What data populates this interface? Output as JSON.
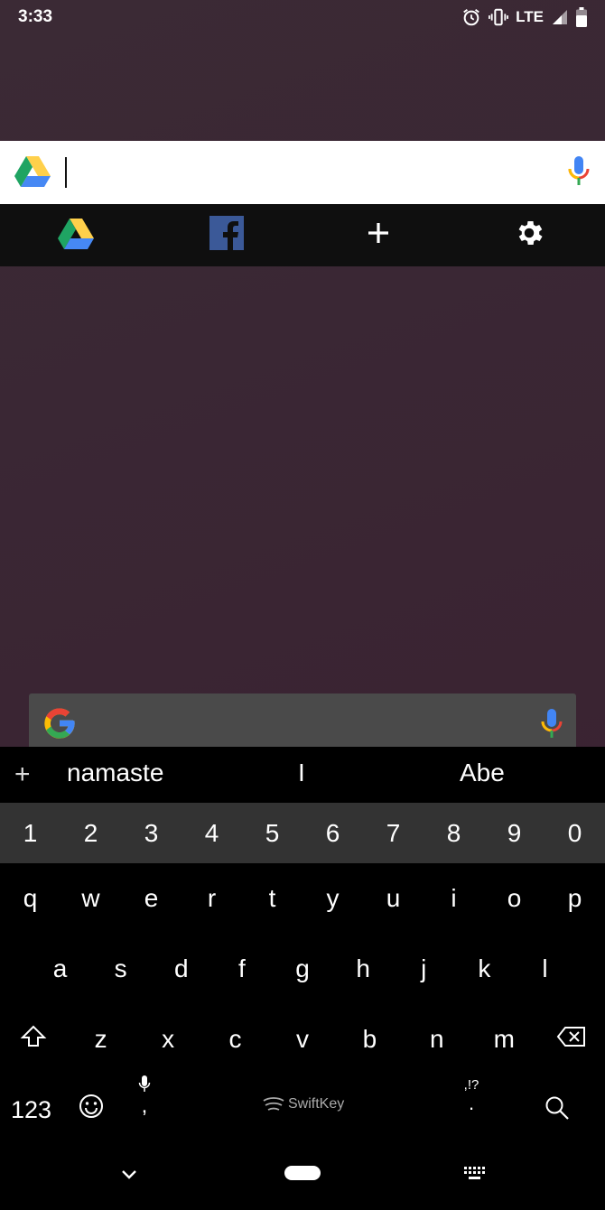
{
  "status_bar": {
    "time": "3:33",
    "network": "LTE",
    "icons": [
      "alarm-icon",
      "vibrate-icon",
      "signal-icon",
      "battery-icon"
    ]
  },
  "search_widget": {
    "leading_icon": "google-drive-icon",
    "trailing_icon": "google-mic-icon"
  },
  "shortcuts": [
    {
      "name": "google-drive-icon"
    },
    {
      "name": "facebook-icon"
    },
    {
      "name": "plus-icon"
    },
    {
      "name": "gear-icon"
    }
  ],
  "google_bar": {
    "leading_icon": "google-g-icon",
    "trailing_icon": "google-mic-icon"
  },
  "keyboard": {
    "suggestions": [
      "namaste",
      "I",
      "Abe"
    ],
    "suggestion_plus": "+",
    "number_row": [
      "1",
      "2",
      "3",
      "4",
      "5",
      "6",
      "7",
      "8",
      "9",
      "0"
    ],
    "row1": [
      "q",
      "w",
      "e",
      "r",
      "t",
      "y",
      "u",
      "i",
      "o",
      "p"
    ],
    "row2": [
      "a",
      "s",
      "d",
      "f",
      "g",
      "h",
      "j",
      "k",
      "l"
    ],
    "row3": [
      "z",
      "x",
      "c",
      "v",
      "b",
      "n",
      "m"
    ],
    "symbols_key": "123",
    "comma_key": ",",
    "space_brand": "SwiftKey",
    "punct_key_top": ",!?",
    "punct_key_bottom": "."
  },
  "colors": {
    "drive_green": "#1fa463",
    "drive_yellow": "#ffd04b",
    "drive_blue": "#4688f4",
    "facebook_blue": "#3b5998",
    "google_red": "#ea4335",
    "google_yellow": "#fbbc05",
    "google_green": "#34a853",
    "google_blue": "#4285f4"
  }
}
